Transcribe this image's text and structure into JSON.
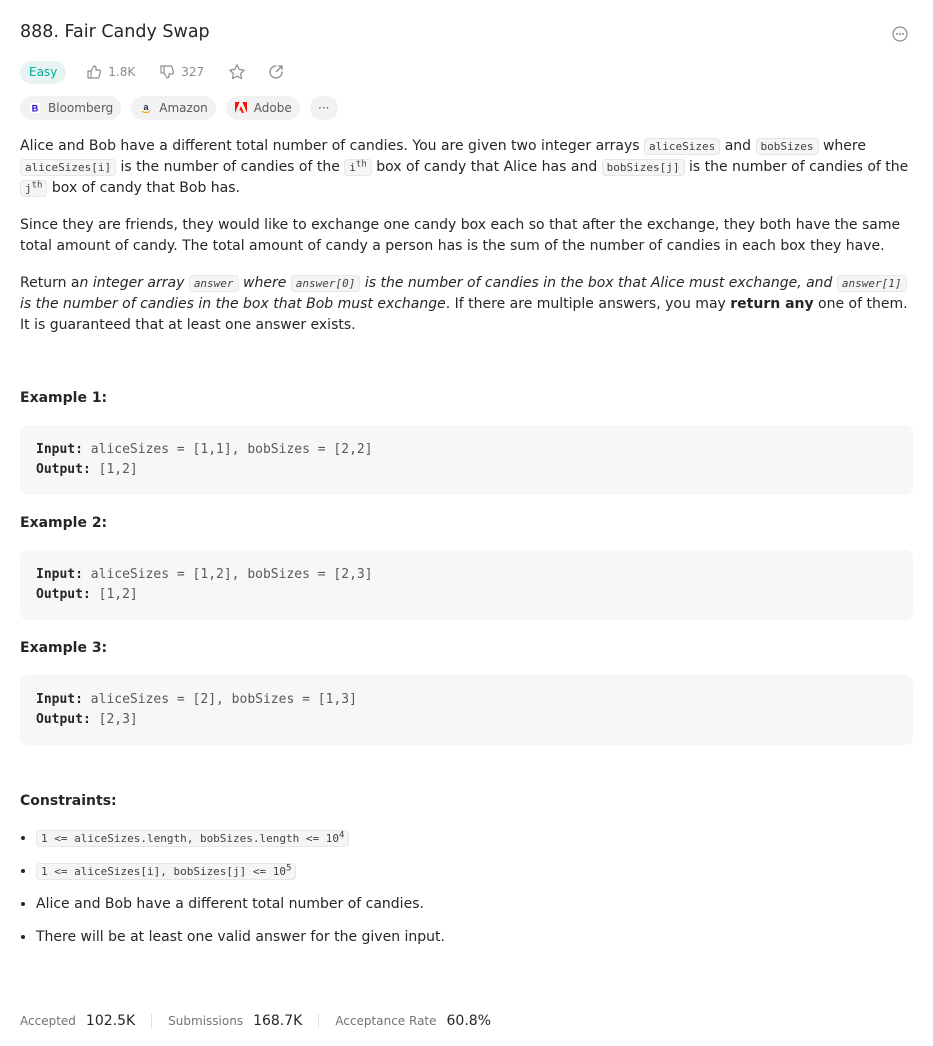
{
  "problem": {
    "title": "888. Fair Candy Swap",
    "difficulty": "Easy",
    "likes": "1.8K",
    "dislikes": "327"
  },
  "companies": [
    {
      "name": "Bloomberg",
      "icon": "bloomberg-logo"
    },
    {
      "name": "Amazon",
      "icon": "amazon-logo"
    },
    {
      "name": "Adobe",
      "icon": "adobe-logo"
    }
  ],
  "more_companies": "···",
  "description": {
    "p1": {
      "t1": "Alice and Bob have a different total number of candies. You are given two integer arrays ",
      "c1": "aliceSizes",
      "t2": " and ",
      "c2": "bobSizes",
      "t3": " where ",
      "c3": "aliceSizes[i]",
      "t4": " is the number of candies of the ",
      "c4": "i",
      "s4": "th",
      "t5": " box of candy that Alice has and ",
      "c5": "bobSizes[j]",
      "t6": " is the number of candies of the ",
      "c6": "j",
      "s6": "th",
      "t7": " box of candy that Bob has."
    },
    "p2": "Since they are friends, they would like to exchange one candy box each so that after the exchange, they both have the same total amount of candy. The total amount of candy a person has is the sum of the number of candies in each box they have.",
    "p3": {
      "t1": "Return a",
      "i1": "n integer array ",
      "c1": "answer",
      "i2": " where ",
      "c2": "answer[0]",
      "i3": " is the number of candies in the box that Alice must exchange, and ",
      "c3": "answer[1]",
      "i4": " is the number of candies in the box that Bob must exchange",
      "t2": ". If there are multiple answers, you may ",
      "b1": "return any",
      "t3": " one of them. It is guaranteed that at least one answer exists."
    }
  },
  "examples": [
    {
      "title": "Example 1:",
      "input_label": "Input:",
      "input": "aliceSizes = [1,1], bobSizes = [2,2]",
      "output_label": "Output:",
      "output": "[1,2]"
    },
    {
      "title": "Example 2:",
      "input_label": "Input:",
      "input": "aliceSizes = [1,2], bobSizes = [2,3]",
      "output_label": "Output:",
      "output": "[1,2]"
    },
    {
      "title": "Example 3:",
      "input_label": "Input:",
      "input": "aliceSizes = [2], bobSizes = [1,3]",
      "output_label": "Output:",
      "output": "[2,3]"
    }
  ],
  "constraints": {
    "title": "Constraints:",
    "c1_code": "1 <= aliceSizes.length, bobSizes.length <= 10",
    "c1_sup": "4",
    "c2_code": "1 <= aliceSizes[i], bobSizes[j] <= 10",
    "c2_sup": "5",
    "c3": "Alice and Bob have a different total number of candies.",
    "c4": "There will be at least one valid answer for the given input."
  },
  "stats": {
    "accepted_label": "Accepted",
    "accepted": "102.5K",
    "submissions_label": "Submissions",
    "submissions": "168.7K",
    "rate_label": "Acceptance Rate",
    "rate": "60.8%"
  },
  "colors": {
    "easy": "#00af9b",
    "easy_bg": "#e6f4f2",
    "adobe": "#fa0f00",
    "amazon": "#ff9900"
  }
}
